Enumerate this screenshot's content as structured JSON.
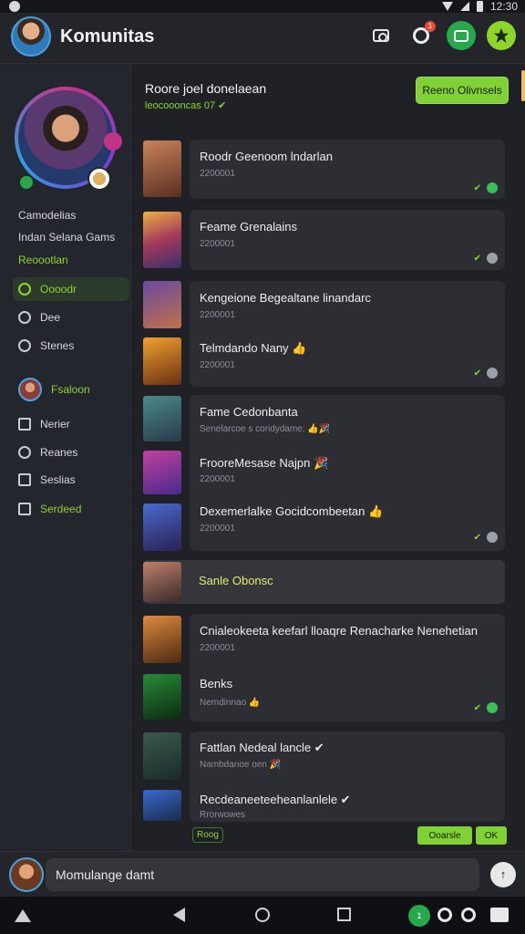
{
  "status_bar": {
    "time": "12:30"
  },
  "header": {
    "title": "Komunitas",
    "notification_count": "1",
    "icons": [
      "camera-icon",
      "notification-icon",
      "chat-icon",
      "app-icon"
    ],
    "colors": {
      "chat": "#27a84a",
      "app": "#8fd42b"
    }
  },
  "sidebar": {
    "text1": "Camodelias",
    "text2": "Indan Selana Gams",
    "text3": "Reoootlan",
    "nav": [
      {
        "label": "Oooodr",
        "icon": "circle-icon"
      },
      {
        "label": "Dee",
        "icon": "search-icon"
      },
      {
        "label": "Stenes",
        "icon": "clock-icon"
      }
    ],
    "friend_label": "Fsaloon",
    "nav2": [
      {
        "label": "Nerier",
        "icon": "edit-icon"
      },
      {
        "label": "Reanes",
        "icon": "clock-icon"
      },
      {
        "label": "Seslias",
        "icon": "square-icon"
      },
      {
        "label": "Serdeed",
        "icon": "chart-icon"
      }
    ]
  },
  "main": {
    "title": "Roore joel donelaean",
    "subtitle": "leocoooncas 07 ✔",
    "button": "Reeno Olivnsels",
    "cards": [
      {
        "title": "Roodr Geenoom lndarlan",
        "sub": "2200001"
      },
      {
        "title": "Feame Grenalains",
        "sub": "2200001"
      },
      {
        "title": "Kengeione Begealtane linandarc",
        "sub": "2200001",
        "line2_title": "Telmdando Nany 👍",
        "line2_sub": "2200001"
      },
      {
        "title": "Fame Cedonbanta",
        "sub": "Senelarcoe s coridydame: 👍🎉",
        "line2_title": "FrooreMesase Najpn 🎉",
        "line2_sub": "2200001",
        "line3_title": "Dexemerlalke Gocidcombeetan 👍",
        "line3_sub": "2200001"
      }
    ],
    "highlight": "Sanle Obonsc",
    "cards2": [
      {
        "title": "Cnialeokeeta keefarl lloaqre Renacharke Nenehetian",
        "sub": "2200001",
        "line2_title": "Benks",
        "line2_sub": "Nemdinnao 👍"
      },
      {
        "title": "Fattlan Nedeal lancle ✔",
        "sub": "Nambdanoe oen 🎉",
        "line2_title": "Recdeaneeteeheanlanlele ✔",
        "line2_sub": "Rrorwowes"
      }
    ],
    "bottom_pill": "Roog",
    "bottom_btn1": "Ooarsle",
    "bottom_btn2": "OK"
  },
  "input": {
    "placeholder": "Momulange damt",
    "send_label": "↑"
  },
  "navbar": {
    "right_pill": "1"
  }
}
